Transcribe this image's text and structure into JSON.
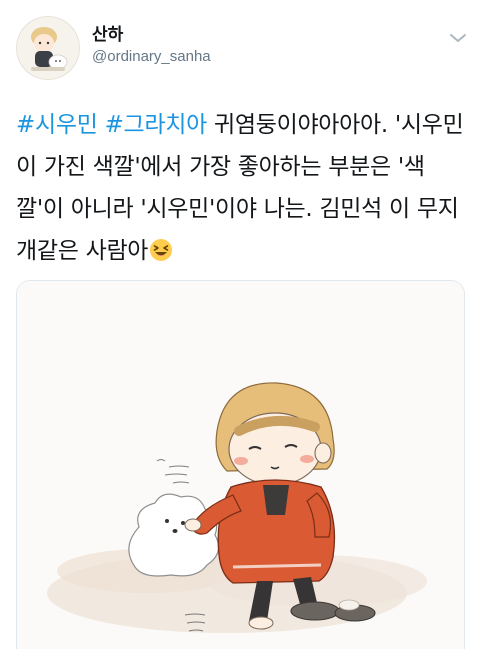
{
  "user": {
    "display_name": "산하",
    "handle": "@ordinary_sanha"
  },
  "tweet": {
    "hashtags": [
      "#시우민",
      "#그라치아"
    ],
    "body_text": " 귀염둥이야아아아. '시우민이 가진 색깔'에서 가장 좋아하는 부분은 '색깔'이 아니라 '시우민'이야 나는. 김민석 이 무지개같은 사람아",
    "emoji": "grinning-squinting-face"
  },
  "colors": {
    "hashtag": "#1b95e0",
    "handle": "#657786",
    "text": "#14171a"
  }
}
